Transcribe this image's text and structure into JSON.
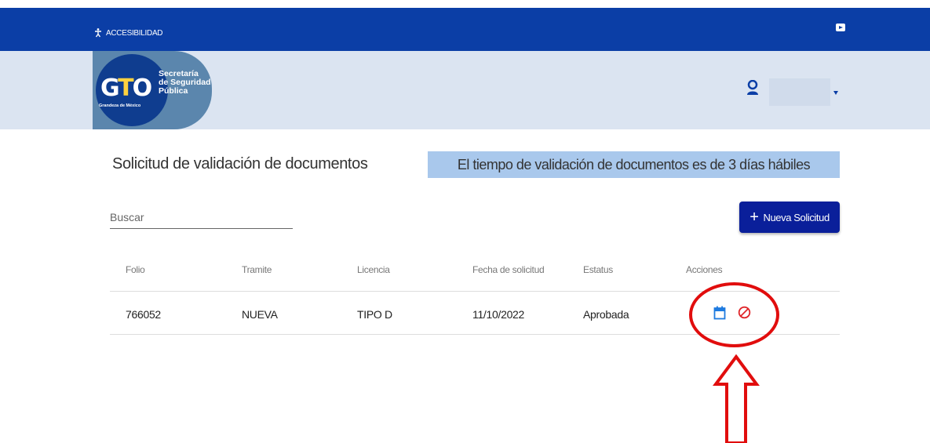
{
  "topbar": {
    "accessibility_label": "ACCESIBILIDAD",
    "social_icon": "youtube-icon",
    "bar_color": "#0b3ea6"
  },
  "header": {
    "logo": {
      "mark": "GTO",
      "tagline": "Grandeza de México",
      "org_line1": "Secretaría",
      "org_line2": "de Seguridad",
      "org_line3": "Pública"
    },
    "user_icon": "user-circle-icon",
    "user_name": "",
    "dropdown_icon": "caret-down-icon",
    "background": "#dbe4f1"
  },
  "main": {
    "title": "Solicitud de validación de documentos",
    "notice": "El tiempo de validación de documentos es de 3 días hábiles",
    "search": {
      "placeholder": "Buscar",
      "value": ""
    },
    "new_button_label": "Nueva Solicitud",
    "accent_color": "#0a1f9a"
  },
  "table": {
    "columns": [
      "Folio",
      "Tramite",
      "Licencia",
      "Fecha de solicitud",
      "Estatus",
      "Acciones"
    ],
    "rows": [
      {
        "folio": "766052",
        "tramite": "NUEVA",
        "licencia": "TIPO D",
        "fecha": "11/10/2022",
        "estatus": "Aprobada",
        "actions": [
          "calendar-icon",
          "cancel-icon"
        ]
      }
    ]
  },
  "annotation": {
    "highlight_color": "#e10d0d",
    "shapes": [
      "circle-highlight",
      "up-arrow"
    ]
  }
}
